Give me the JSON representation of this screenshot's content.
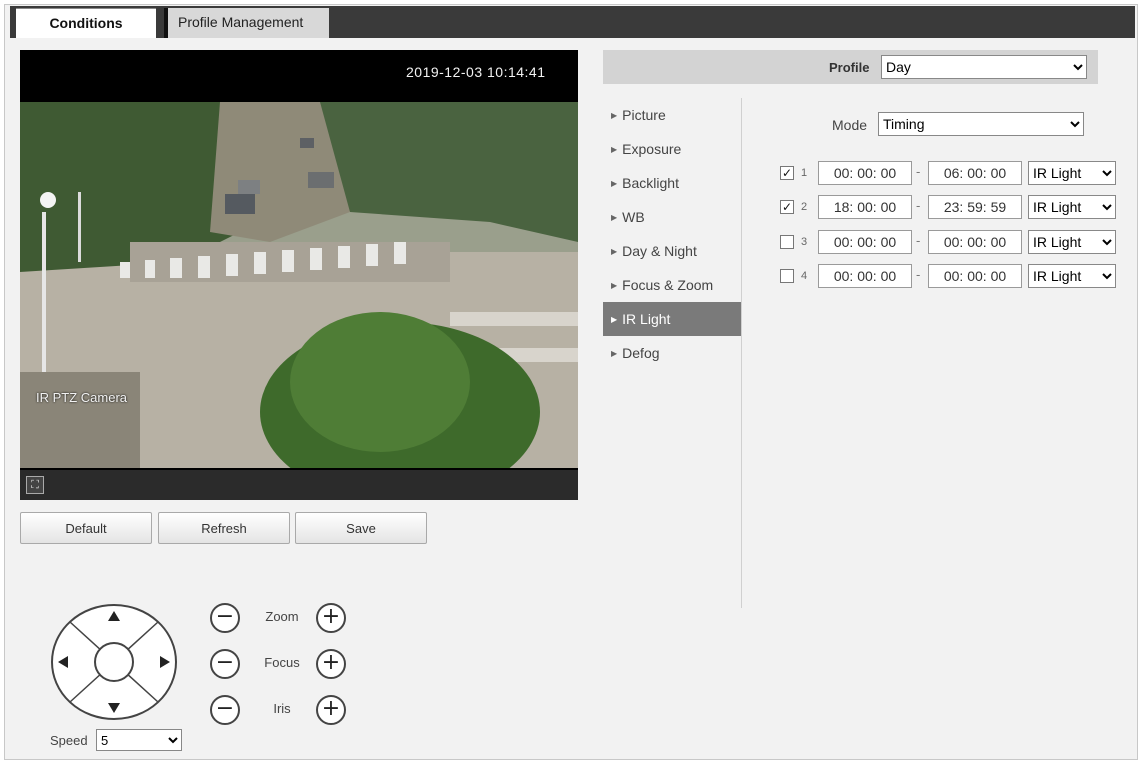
{
  "tabs": [
    {
      "label": "Conditions",
      "active": true
    },
    {
      "label": "Profile Management",
      "active": false
    }
  ],
  "video": {
    "timestamp": "2019-12-03 10:14:41",
    "camera_name": "IR PTZ Camera"
  },
  "actions": {
    "default_label": "Default",
    "refresh_label": "Refresh",
    "save_label": "Save"
  },
  "ptz": {
    "zoom_label": "Zoom",
    "focus_label": "Focus",
    "iris_label": "Iris",
    "minus_glyph": "−",
    "plus_glyph": "+",
    "speed_label": "Speed",
    "speed_value": "5"
  },
  "profile": {
    "label": "Profile",
    "value": "Day"
  },
  "menu": [
    {
      "label": "Picture",
      "active": false
    },
    {
      "label": "Exposure",
      "active": false
    },
    {
      "label": "Backlight",
      "active": false
    },
    {
      "label": "WB",
      "active": false
    },
    {
      "label": "Day & Night",
      "active": false
    },
    {
      "label": "Focus & Zoom",
      "active": false
    },
    {
      "label": "IR Light",
      "active": true
    },
    {
      "label": "Defog",
      "active": false
    }
  ],
  "mode": {
    "label": "Mode",
    "value": "Timing"
  },
  "schedule": [
    {
      "index": "1",
      "checked": true,
      "start": "00:  00:  00",
      "end": "06:  00:  00",
      "light": "IR Light"
    },
    {
      "index": "2",
      "checked": true,
      "start": "18:  00:  00",
      "end": "23:  59:  59",
      "light": "IR Light"
    },
    {
      "index": "3",
      "checked": false,
      "start": "00:  00:  00",
      "end": "00:  00:  00",
      "light": "IR Light"
    },
    {
      "index": "4",
      "checked": false,
      "start": "00:  00:  00",
      "end": "00:  00:  00",
      "light": "IR Light"
    }
  ],
  "colors": {
    "tabbar": "#3a3a3a",
    "menu_active": "#7a7a7a",
    "panel_bg": "#f2f2f2"
  },
  "icons": {
    "fullscreen": "fullscreen-icon",
    "ptz_up": "arrow-up-icon",
    "ptz_down": "arrow-down-icon",
    "ptz_left": "arrow-left-icon",
    "ptz_right": "arrow-right-icon"
  }
}
